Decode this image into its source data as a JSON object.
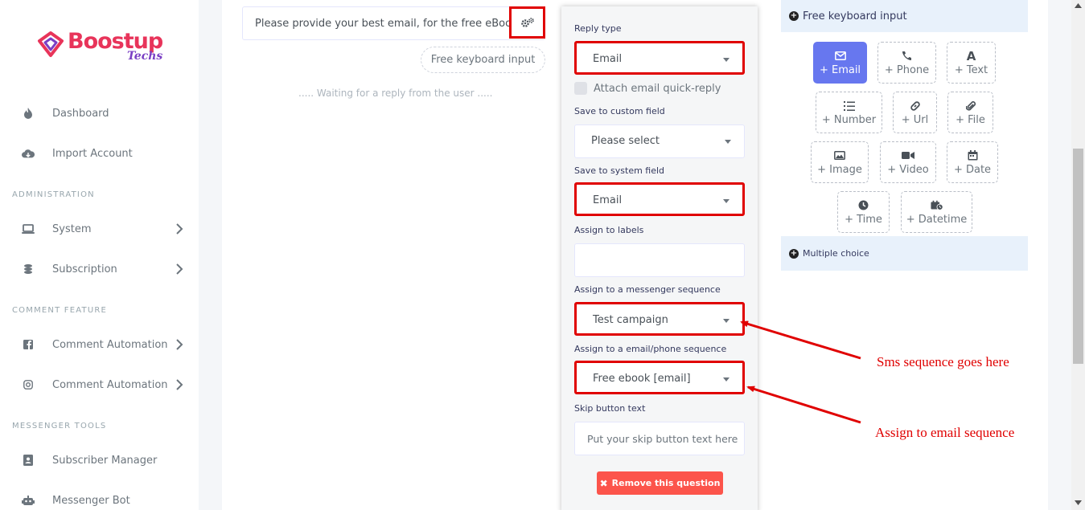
{
  "brand": {
    "name": "Boostup",
    "sub": "Techs"
  },
  "sidebar": {
    "items_top": [
      {
        "label": "Dashboard",
        "icon": "fire-icon"
      },
      {
        "label": "Import Account",
        "icon": "cloud-download-icon"
      }
    ],
    "admin_heading": "ADMINISTRATION",
    "admin_items": [
      {
        "label": "System",
        "icon": "laptop-icon"
      },
      {
        "label": "Subscription",
        "icon": "coins-icon"
      }
    ],
    "comment_heading": "COMMENT FEATURE",
    "comment_items": [
      {
        "label": "Comment Automation",
        "icon": "facebook-icon"
      },
      {
        "label": "Comment Automation",
        "icon": "instagram-icon"
      }
    ],
    "messenger_heading": "MESSENGER TOOLS",
    "messenger_items": [
      {
        "label": "Subscriber Manager",
        "icon": "address-book-icon"
      },
      {
        "label": "Messenger Bot",
        "icon": "robot-icon"
      }
    ]
  },
  "flow": {
    "question_text": "Please provide your best email, for the free eBook",
    "reply_pill": "Free keyboard input",
    "waiting_text": "..... Waiting for a reply from the user ....."
  },
  "panel": {
    "reply_type_label": "Reply type",
    "reply_type_value": "Email",
    "attach_label": "Attach email quick-reply",
    "custom_field_label": "Save to custom field",
    "custom_field_value": "Please select",
    "system_field_label": "Save to system field",
    "system_field_value": "Email",
    "labels_label": "Assign to labels",
    "messenger_seq_label": "Assign to a messenger sequence",
    "messenger_seq_value": "Test campaign",
    "email_seq_label": "Assign to a email/phone sequence",
    "email_seq_value": "Free ebook [email]",
    "skip_label": "Skip button text",
    "skip_placeholder": "Put your skip button text here",
    "remove_label": "Remove this question"
  },
  "right": {
    "section1": "Free keyboard input",
    "section2": "Multiple choice",
    "tiles": [
      {
        "label": "+ Email",
        "icon": "envelope-icon"
      },
      {
        "label": "+ Phone",
        "icon": "phone-icon"
      },
      {
        "label": "+ Text",
        "icon": "font-icon"
      },
      {
        "label": "+ Number",
        "icon": "list-ol-icon"
      },
      {
        "label": "+ Url",
        "icon": "link-icon"
      },
      {
        "label": "+ File",
        "icon": "paperclip-icon"
      },
      {
        "label": "+ Image",
        "icon": "image-icon"
      },
      {
        "label": "+ Video",
        "icon": "video-icon"
      },
      {
        "label": "+ Date",
        "icon": "calendar-icon"
      },
      {
        "label": "+ Time",
        "icon": "clock-icon"
      },
      {
        "label": "+ Datetime",
        "icon": "calendar-clock-icon"
      }
    ]
  },
  "annotations": {
    "sms": "Sms sequence goes here",
    "email": "Assign to email sequence"
  },
  "colors": {
    "highlight": "#e00000",
    "accent": "#6777ef",
    "danger": "#fc544b"
  }
}
